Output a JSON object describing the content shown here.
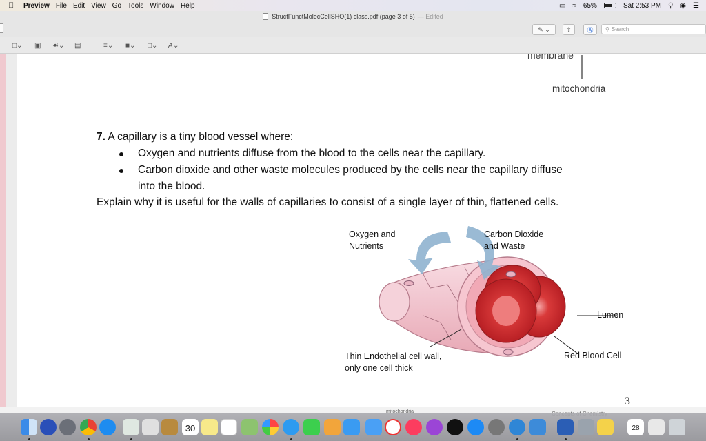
{
  "menubar": {
    "items": [
      "Preview",
      "File",
      "Edit",
      "View",
      "Go",
      "Tools",
      "Window",
      "Help"
    ],
    "battery": "65%",
    "clock": "Sat 2:53 PM"
  },
  "window": {
    "title": "StructFunctMolecCellSHO(1) class.pdf (page 3 of 5)",
    "edited": "— Edited",
    "search_placeholder": "Search"
  },
  "page": {
    "top_label_membrane": "membrane",
    "top_label_mitochondria": "mitochondria",
    "question_number": "7.",
    "question_intro": "A capillary is a tiny blood vessel where:",
    "bullet_1": "Oxygen and nutrients diffuse from the blood to the cells near the capillary.",
    "bullet_2_line1": "Carbon dioxide and other waste molecules produced by the cells near the capillary diffuse",
    "bullet_2_line2": "into the blood.",
    "question_prompt": "Explain why it is useful for the walls of capillaries to consist of a single layer of thin, flattened cells.",
    "page_number": "3"
  },
  "diagram": {
    "label_oxygen_1": "Oxygen and",
    "label_oxygen_2": "Nutrients",
    "label_co2_1": "Carbon Dioxide",
    "label_co2_2": "and Waste",
    "label_lumen": "Lumen",
    "label_rbc": "Red Blood Cell",
    "label_wall_1": "Thin Endothelial cell wall,",
    "label_wall_2": "only one cell thick"
  },
  "dock": {
    "calendar_day": "30",
    "calendar_day_2": "28",
    "strip_text": "mitochondria",
    "strip_text_right": "Concepts of Chemistry"
  },
  "colors": {
    "vessel_pink": "#f3c6cf",
    "rbc_red": "#d93a3a",
    "arrow_blue": "#8fb3cf",
    "menubar_bg": "#ebe8ee"
  }
}
